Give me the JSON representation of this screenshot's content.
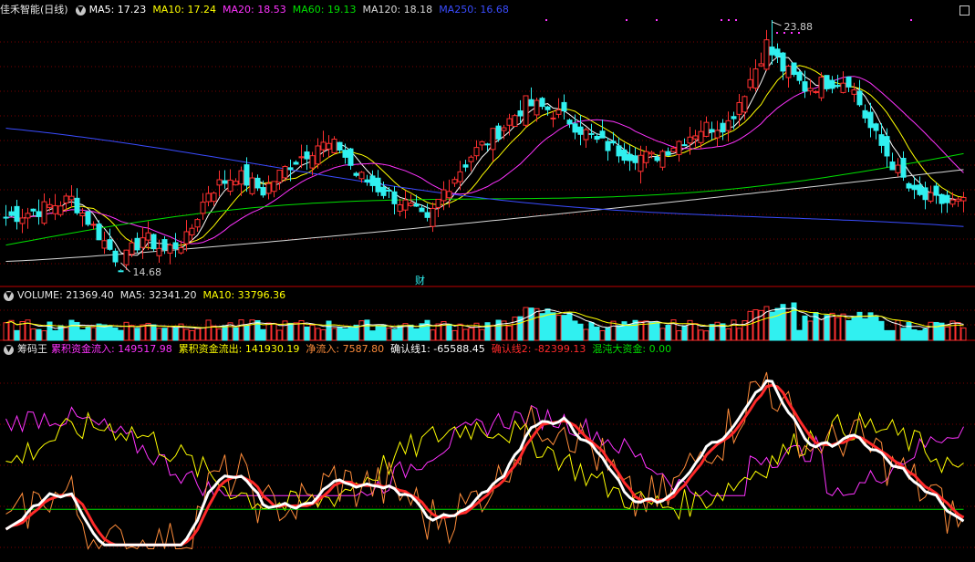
{
  "main": {
    "title": "佳禾智能(日线)",
    "ma_labels": [
      {
        "text": "MA5: 17.23",
        "color": "#ffffff"
      },
      {
        "text": "MA10: 17.24",
        "color": "#ffff00"
      },
      {
        "text": "MA20: 18.53",
        "color": "#ff33ff"
      },
      {
        "text": "MA60: 19.13",
        "color": "#00e000"
      },
      {
        "text": "MA120: 18.18",
        "color": "#d8d8d8"
      },
      {
        "text": "MA250: 16.68",
        "color": "#3a4cff"
      }
    ],
    "high_label": "23.88",
    "low_label": "14.68",
    "event_marker": "财"
  },
  "volume": {
    "labels": [
      {
        "text": "VOLUME: 21369.40",
        "color": "#e6e6e6"
      },
      {
        "text": "MA5: 32341.20",
        "color": "#e6e6e6"
      },
      {
        "text": "MA10: 33796.36",
        "color": "#ffff00"
      }
    ]
  },
  "indicator": {
    "title": "筹码王",
    "labels": [
      {
        "text": "累积资金流入: 149517.98",
        "color": "#ff33ff"
      },
      {
        "text": "累积资金流出: 141930.19",
        "color": "#ffff00"
      },
      {
        "text": "净流入: 7587.80",
        "color": "#ff8c3a"
      },
      {
        "text": "确认线1: -65588.45",
        "color": "#ffffff"
      },
      {
        "text": "确认线2: -82399.13",
        "color": "#ff2a2a"
      },
      {
        "text": "混沌大资金: 0.00",
        "color": "#00e000"
      }
    ]
  },
  "colors": {
    "up": "#ff3030",
    "down": "#30f0f0",
    "grid": "#7a0000",
    "divider": "#c00000"
  },
  "chart_data": [
    {
      "type": "candlestick",
      "price_range": [
        14.68,
        23.88
      ],
      "high": 23.88,
      "low": 14.68,
      "ma_latest": {
        "MA5": 17.23,
        "MA10": 17.24,
        "MA20": 18.53,
        "MA60": 19.13,
        "MA120": 18.18,
        "MA250": 16.68
      }
    },
    {
      "type": "bar",
      "latest": {
        "VOLUME": 21369.4,
        "MA5": 32341.2,
        "MA10": 33796.36
      }
    },
    {
      "type": "line",
      "latest": {
        "累积资金流入": 149517.98,
        "累积资金流出": 141930.19,
        "净流入": 7587.8,
        "确认线1": -65588.45,
        "确认线2": -82399.13,
        "混沌大资金": 0.0
      }
    }
  ]
}
